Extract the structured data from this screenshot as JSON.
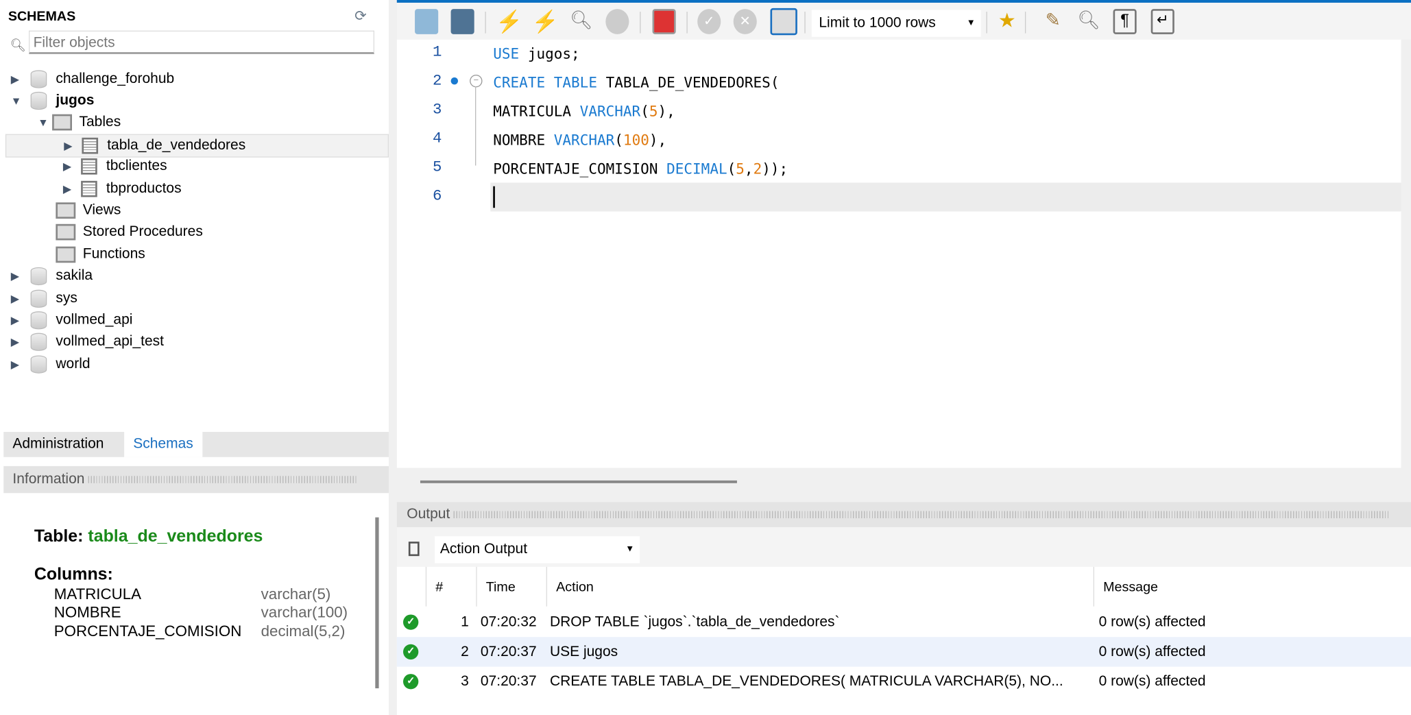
{
  "sidebar": {
    "title": "SCHEMAS",
    "filter_placeholder": "Filter objects",
    "tree": {
      "challenge_forohub": "challenge_forohub",
      "jugos": "jugos",
      "tables": "Tables",
      "t1": "tabla_de_vendedores",
      "t2": "tbclientes",
      "t3": "tbproductos",
      "views": "Views",
      "procs": "Stored Procedures",
      "funcs": "Functions",
      "sakila": "sakila",
      "sys": "sys",
      "vollmed_api": "vollmed_api",
      "vollmed_api_test": "vollmed_api_test",
      "world": "world"
    },
    "tabs": [
      "Administration",
      "Schemas"
    ]
  },
  "info": {
    "header": "Information",
    "table_label": "Table:",
    "table_name": "tabla_de_vendedores",
    "columns_label": "Columns:",
    "columns": [
      {
        "name": "MATRICULA",
        "type": "varchar(5)"
      },
      {
        "name": "NOMBRE",
        "type": "varchar(100)"
      },
      {
        "name": "PORCENTAJE_COMISION",
        "type": "decimal(5,2)"
      }
    ]
  },
  "toolbar": {
    "limit": "Limit to 1000 rows"
  },
  "editor": {
    "line_numbers": [
      "1",
      "2",
      "3",
      "4",
      "5",
      "6"
    ],
    "lines": [
      [
        [
          "kw",
          "USE"
        ],
        [
          "plain",
          " jugos;"
        ]
      ],
      [
        [
          "kw",
          "CREATE TABLE"
        ],
        [
          "plain",
          " TABLA_DE_VENDEDORES("
        ]
      ],
      [
        [
          "plain",
          "MATRICULA "
        ],
        [
          "kw",
          "VARCHAR"
        ],
        [
          "plain",
          "("
        ],
        [
          "num",
          "5"
        ],
        [
          "plain",
          "),"
        ]
      ],
      [
        [
          "plain",
          "NOMBRE "
        ],
        [
          "kw",
          "VARCHAR"
        ],
        [
          "plain",
          "("
        ],
        [
          "num",
          "100"
        ],
        [
          "plain",
          "),"
        ]
      ],
      [
        [
          "plain",
          "PORCENTAJE_COMISION "
        ],
        [
          "kw",
          "DECIMAL"
        ],
        [
          "plain",
          "("
        ],
        [
          "num",
          "5"
        ],
        [
          "plain",
          ","
        ],
        [
          "num",
          "2"
        ],
        [
          "plain",
          "));"
        ]
      ],
      []
    ]
  },
  "output": {
    "header": "Output",
    "selector": "Action Output",
    "columns": [
      "#",
      "Time",
      "Action",
      "Message"
    ],
    "rows": [
      {
        "n": "1",
        "time": "07:20:32",
        "action": "DROP TABLE `jugos`.`tabla_de_vendedores`",
        "message": "0 row(s) affected"
      },
      {
        "n": "2",
        "time": "07:20:37",
        "action": "USE jugos",
        "message": "0 row(s) affected"
      },
      {
        "n": "3",
        "time": "07:20:37",
        "action": "CREATE TABLE TABLA_DE_VENDEDORES( MATRICULA VARCHAR(5), NO...",
        "message": "0 row(s) affected"
      }
    ]
  }
}
